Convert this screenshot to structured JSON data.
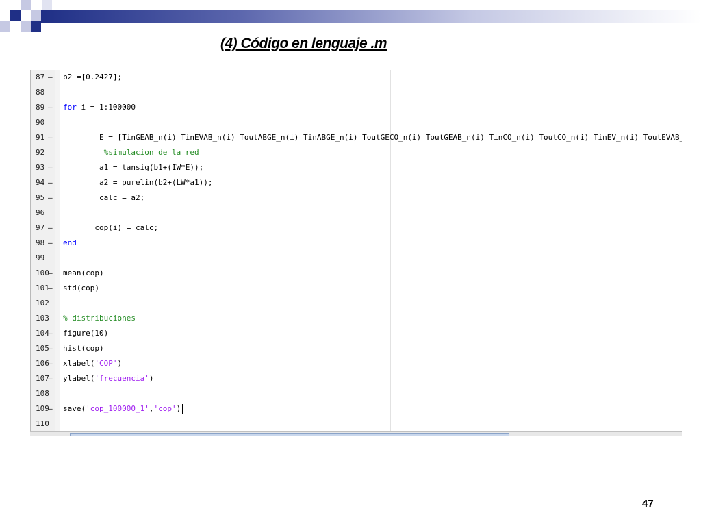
{
  "slide": {
    "title": "(4) Código en lenguaje .m",
    "page_number": "47"
  },
  "editor": {
    "lines": [
      {
        "num": "87",
        "dash": "–",
        "parts": [
          {
            "t": "b2 =[0.2427];",
            "c": ""
          }
        ]
      },
      {
        "num": "88",
        "dash": "",
        "parts": []
      },
      {
        "num": "89",
        "dash": "–",
        "parts": [
          {
            "t": "for",
            "c": "kw"
          },
          {
            "t": " i = 1:100000",
            "c": ""
          }
        ]
      },
      {
        "num": "90",
        "dash": "",
        "parts": []
      },
      {
        "num": "91",
        "dash": "–",
        "parts": [
          {
            "t": "        E = [TinGEAB_n(i) TinEVAB_n(i) ToutABGE_n(i) TinABGE_n(i) ToutGECO_n(i) ToutGEAB_n(i) TinCO_n(i) ToutCO_n(i) TinEV_n(i) ToutEVAB_n(i)",
            "c": ""
          }
        ]
      },
      {
        "num": "92",
        "dash": "",
        "parts": [
          {
            "t": "         %simulacion de la red",
            "c": "cm"
          }
        ]
      },
      {
        "num": "93",
        "dash": "–",
        "parts": [
          {
            "t": "        a1 = tansig(b1+(IW*E));",
            "c": ""
          }
        ]
      },
      {
        "num": "94",
        "dash": "–",
        "parts": [
          {
            "t": "        a2 = purelin(b2+(LW*a1));",
            "c": ""
          }
        ]
      },
      {
        "num": "95",
        "dash": "–",
        "parts": [
          {
            "t": "        calc = a2;",
            "c": ""
          }
        ]
      },
      {
        "num": "96",
        "dash": "",
        "parts": []
      },
      {
        "num": "97",
        "dash": "–",
        "parts": [
          {
            "t": "       cop(i) = calc;",
            "c": ""
          }
        ]
      },
      {
        "num": "98",
        "dash": "–",
        "parts": [
          {
            "t": "end",
            "c": "kw"
          }
        ]
      },
      {
        "num": "99",
        "dash": "",
        "parts": []
      },
      {
        "num": "100",
        "dash": "–",
        "parts": [
          {
            "t": "mean(cop)",
            "c": ""
          }
        ]
      },
      {
        "num": "101",
        "dash": "–",
        "parts": [
          {
            "t": "std(cop)",
            "c": ""
          }
        ]
      },
      {
        "num": "102",
        "dash": "",
        "parts": []
      },
      {
        "num": "103",
        "dash": "",
        "parts": [
          {
            "t": "% distribuciones",
            "c": "cm"
          }
        ]
      },
      {
        "num": "104",
        "dash": "–",
        "parts": [
          {
            "t": "figure(10)",
            "c": ""
          }
        ]
      },
      {
        "num": "105",
        "dash": "–",
        "parts": [
          {
            "t": "hist(cop)",
            "c": ""
          }
        ]
      },
      {
        "num": "106",
        "dash": "–",
        "parts": [
          {
            "t": "xlabel(",
            "c": ""
          },
          {
            "t": "'COP'",
            "c": "str"
          },
          {
            "t": ")",
            "c": ""
          }
        ]
      },
      {
        "num": "107",
        "dash": "–",
        "parts": [
          {
            "t": "ylabel(",
            "c": ""
          },
          {
            "t": "'frecuencia'",
            "c": "str"
          },
          {
            "t": ")",
            "c": ""
          }
        ]
      },
      {
        "num": "108",
        "dash": "",
        "parts": []
      },
      {
        "num": "109",
        "dash": "–",
        "parts": [
          {
            "t": "save(",
            "c": ""
          },
          {
            "t": "'cop_100000_1'",
            "c": "str"
          },
          {
            "t": ",",
            "c": ""
          },
          {
            "t": "'cop'",
            "c": "str"
          },
          {
            "t": ")",
            "c": ""
          }
        ],
        "caret": true
      },
      {
        "num": "110",
        "dash": "",
        "parts": []
      }
    ]
  }
}
